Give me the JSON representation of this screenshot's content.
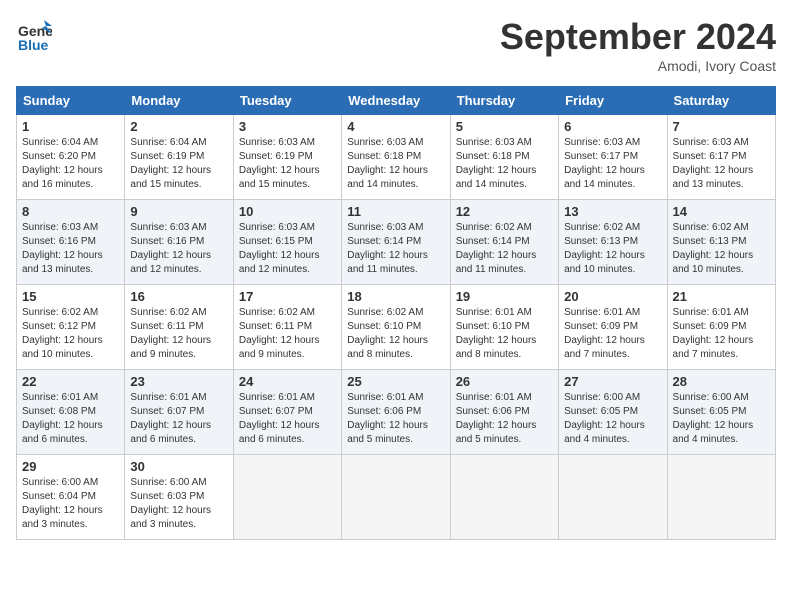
{
  "header": {
    "logo_line1": "General",
    "logo_line2": "Blue",
    "month": "September 2024",
    "location": "Amodi, Ivory Coast"
  },
  "days_of_week": [
    "Sunday",
    "Monday",
    "Tuesday",
    "Wednesday",
    "Thursday",
    "Friday",
    "Saturday"
  ],
  "weeks": [
    [
      {
        "day": "1",
        "info": "Sunrise: 6:04 AM\nSunset: 6:20 PM\nDaylight: 12 hours\nand 16 minutes."
      },
      {
        "day": "2",
        "info": "Sunrise: 6:04 AM\nSunset: 6:19 PM\nDaylight: 12 hours\nand 15 minutes."
      },
      {
        "day": "3",
        "info": "Sunrise: 6:03 AM\nSunset: 6:19 PM\nDaylight: 12 hours\nand 15 minutes."
      },
      {
        "day": "4",
        "info": "Sunrise: 6:03 AM\nSunset: 6:18 PM\nDaylight: 12 hours\nand 14 minutes."
      },
      {
        "day": "5",
        "info": "Sunrise: 6:03 AM\nSunset: 6:18 PM\nDaylight: 12 hours\nand 14 minutes."
      },
      {
        "day": "6",
        "info": "Sunrise: 6:03 AM\nSunset: 6:17 PM\nDaylight: 12 hours\nand 14 minutes."
      },
      {
        "day": "7",
        "info": "Sunrise: 6:03 AM\nSunset: 6:17 PM\nDaylight: 12 hours\nand 13 minutes."
      }
    ],
    [
      {
        "day": "8",
        "info": "Sunrise: 6:03 AM\nSunset: 6:16 PM\nDaylight: 12 hours\nand 13 minutes."
      },
      {
        "day": "9",
        "info": "Sunrise: 6:03 AM\nSunset: 6:16 PM\nDaylight: 12 hours\nand 12 minutes."
      },
      {
        "day": "10",
        "info": "Sunrise: 6:03 AM\nSunset: 6:15 PM\nDaylight: 12 hours\nand 12 minutes."
      },
      {
        "day": "11",
        "info": "Sunrise: 6:03 AM\nSunset: 6:14 PM\nDaylight: 12 hours\nand 11 minutes."
      },
      {
        "day": "12",
        "info": "Sunrise: 6:02 AM\nSunset: 6:14 PM\nDaylight: 12 hours\nand 11 minutes."
      },
      {
        "day": "13",
        "info": "Sunrise: 6:02 AM\nSunset: 6:13 PM\nDaylight: 12 hours\nand 10 minutes."
      },
      {
        "day": "14",
        "info": "Sunrise: 6:02 AM\nSunset: 6:13 PM\nDaylight: 12 hours\nand 10 minutes."
      }
    ],
    [
      {
        "day": "15",
        "info": "Sunrise: 6:02 AM\nSunset: 6:12 PM\nDaylight: 12 hours\nand 10 minutes."
      },
      {
        "day": "16",
        "info": "Sunrise: 6:02 AM\nSunset: 6:11 PM\nDaylight: 12 hours\nand 9 minutes."
      },
      {
        "day": "17",
        "info": "Sunrise: 6:02 AM\nSunset: 6:11 PM\nDaylight: 12 hours\nand 9 minutes."
      },
      {
        "day": "18",
        "info": "Sunrise: 6:02 AM\nSunset: 6:10 PM\nDaylight: 12 hours\nand 8 minutes."
      },
      {
        "day": "19",
        "info": "Sunrise: 6:01 AM\nSunset: 6:10 PM\nDaylight: 12 hours\nand 8 minutes."
      },
      {
        "day": "20",
        "info": "Sunrise: 6:01 AM\nSunset: 6:09 PM\nDaylight: 12 hours\nand 7 minutes."
      },
      {
        "day": "21",
        "info": "Sunrise: 6:01 AM\nSunset: 6:09 PM\nDaylight: 12 hours\nand 7 minutes."
      }
    ],
    [
      {
        "day": "22",
        "info": "Sunrise: 6:01 AM\nSunset: 6:08 PM\nDaylight: 12 hours\nand 6 minutes."
      },
      {
        "day": "23",
        "info": "Sunrise: 6:01 AM\nSunset: 6:07 PM\nDaylight: 12 hours\nand 6 minutes."
      },
      {
        "day": "24",
        "info": "Sunrise: 6:01 AM\nSunset: 6:07 PM\nDaylight: 12 hours\nand 6 minutes."
      },
      {
        "day": "25",
        "info": "Sunrise: 6:01 AM\nSunset: 6:06 PM\nDaylight: 12 hours\nand 5 minutes."
      },
      {
        "day": "26",
        "info": "Sunrise: 6:01 AM\nSunset: 6:06 PM\nDaylight: 12 hours\nand 5 minutes."
      },
      {
        "day": "27",
        "info": "Sunrise: 6:00 AM\nSunset: 6:05 PM\nDaylight: 12 hours\nand 4 minutes."
      },
      {
        "day": "28",
        "info": "Sunrise: 6:00 AM\nSunset: 6:05 PM\nDaylight: 12 hours\nand 4 minutes."
      }
    ],
    [
      {
        "day": "29",
        "info": "Sunrise: 6:00 AM\nSunset: 6:04 PM\nDaylight: 12 hours\nand 3 minutes."
      },
      {
        "day": "30",
        "info": "Sunrise: 6:00 AM\nSunset: 6:03 PM\nDaylight: 12 hours\nand 3 minutes."
      },
      {
        "day": "",
        "info": ""
      },
      {
        "day": "",
        "info": ""
      },
      {
        "day": "",
        "info": ""
      },
      {
        "day": "",
        "info": ""
      },
      {
        "day": "",
        "info": ""
      }
    ]
  ]
}
